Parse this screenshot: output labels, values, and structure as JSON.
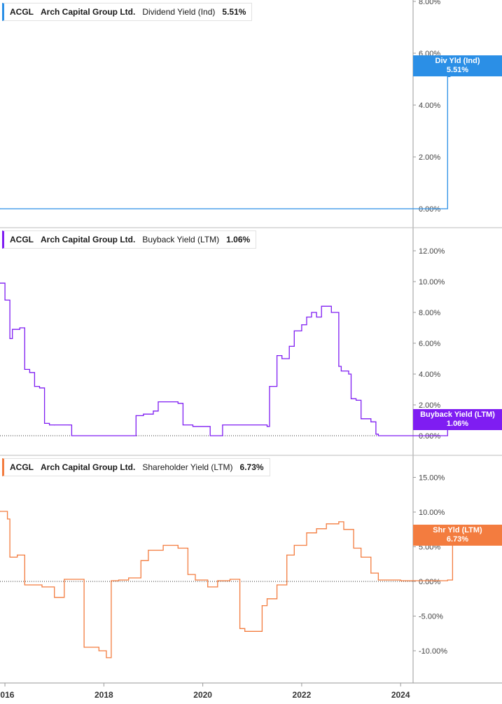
{
  "ticker": "ACGL",
  "company": "Arch Capital Group Ltd.",
  "chart_data": [
    {
      "type": "line",
      "series": [
        {
          "name": "Dividend Yield (Ind)",
          "last_value": "5.51%"
        }
      ],
      "tag": {
        "label": "Div Yld (Ind)",
        "value": "5.51%"
      },
      "color": "#2b8fe6",
      "yticks": [
        "8.00%",
        "6.00%",
        "4.00%",
        "2.00%",
        "0.00%"
      ],
      "ylim": [
        0,
        8
      ],
      "x": [
        2015.9,
        2024.85,
        2024.9,
        2024.95,
        2025.0,
        2025.1,
        2025.2,
        2025.3,
        2025.4,
        2025.5,
        2025.6,
        2025.65
      ],
      "y": [
        0,
        0,
        0,
        5.1,
        5.4,
        5.7,
        5.5,
        5.8,
        5.5,
        5.9,
        5.6,
        5.51
      ]
    },
    {
      "type": "line",
      "series": [
        {
          "name": "Buyback Yield (LTM)",
          "last_value": "1.06%"
        }
      ],
      "tag": {
        "label": "Buyback Yield (LTM)",
        "value": "1.06%"
      },
      "color": "#7f1df2",
      "yticks": [
        "12.00%",
        "10.00%",
        "8.00%",
        "6.00%",
        "4.00%",
        "2.00%",
        "0.00%"
      ],
      "ylim": [
        0,
        12
      ],
      "x": [
        2015.9,
        2016.0,
        2016.1,
        2016.15,
        2016.3,
        2016.4,
        2016.5,
        2016.6,
        2016.7,
        2016.8,
        2016.9,
        2017.0,
        2017.3,
        2017.35,
        2018.6,
        2018.65,
        2018.8,
        2019.0,
        2019.1,
        2019.5,
        2019.6,
        2019.8,
        2020.1,
        2020.15,
        2020.35,
        2020.4,
        2021.3,
        2021.35,
        2021.5,
        2021.6,
        2021.75,
        2021.85,
        2022.0,
        2022.1,
        2022.2,
        2022.3,
        2022.4,
        2022.6,
        2022.75,
        2022.8,
        2022.95,
        2023.0,
        2023.1,
        2023.2,
        2023.4,
        2023.5,
        2023.55,
        2024.9,
        2024.95,
        2025.25,
        2025.3,
        2025.4
      ],
      "y": [
        9.9,
        8.8,
        6.3,
        6.9,
        7.0,
        4.3,
        4.1,
        3.2,
        3.1,
        0.8,
        0.7,
        0.7,
        0.7,
        0,
        0,
        1.3,
        1.4,
        1.6,
        2.2,
        2.1,
        0.7,
        0.6,
        0.6,
        0,
        0,
        0.7,
        0.6,
        3.2,
        5.2,
        5.0,
        5.8,
        6.8,
        7.2,
        7.7,
        8.0,
        7.7,
        8.4,
        8.0,
        4.5,
        4.2,
        4.0,
        2.4,
        2.3,
        1.1,
        0.9,
        0.1,
        0,
        0,
        0.8,
        0.9,
        0.8,
        1.06
      ]
    },
    {
      "type": "line",
      "series": [
        {
          "name": "Shareholder Yield (LTM)",
          "last_value": "6.73%"
        }
      ],
      "tag": {
        "label": "Shr Yld (LTM)",
        "value": "6.73%"
      },
      "color": "#f37c3f",
      "yticks": [
        "15.00%",
        "10.00%",
        "5.00%",
        "0.00%",
        "-5.00%",
        "-10.00%"
      ],
      "ylim": [
        -14.5,
        16.5
      ],
      "x": [
        2015.9,
        2016.05,
        2016.1,
        2016.25,
        2016.4,
        2016.5,
        2016.75,
        2017.0,
        2017.2,
        2017.25,
        2017.6,
        2017.9,
        2018.05,
        2018.15,
        2018.3,
        2018.5,
        2018.75,
        2018.9,
        2019.2,
        2019.5,
        2019.7,
        2019.85,
        2020.1,
        2020.3,
        2020.55,
        2020.75,
        2020.85,
        2021.2,
        2021.3,
        2021.5,
        2021.7,
        2021.85,
        2022.1,
        2022.3,
        2022.5,
        2022.75,
        2022.85,
        2023.05,
        2023.2,
        2023.4,
        2023.55,
        2024.0,
        2024.5,
        2024.95,
        2025.05,
        2025.4,
        2025.65
      ],
      "y": [
        10.1,
        9.0,
        3.5,
        3.8,
        -0.5,
        -0.5,
        -0.8,
        -2.3,
        0.3,
        0.3,
        -9.5,
        -10.0,
        -11.0,
        0.1,
        0.2,
        0.5,
        3.0,
        4.5,
        5.2,
        4.8,
        1.0,
        0.2,
        -0.8,
        0.1,
        0.3,
        -6.8,
        -7.2,
        -3.5,
        -2.5,
        -0.5,
        3.8,
        5.2,
        7.0,
        7.6,
        8.3,
        8.6,
        7.5,
        4.8,
        3.5,
        1.2,
        0.2,
        0.1,
        0.1,
        0.2,
        5.8,
        6.2,
        6.73
      ]
    }
  ],
  "x_axis": {
    "ticks": [
      "2016",
      "2018",
      "2020",
      "2022",
      "2024"
    ],
    "values": [
      2016,
      2018,
      2020,
      2022,
      2024
    ],
    "xlim": [
      2015.9,
      2026.05
    ]
  }
}
